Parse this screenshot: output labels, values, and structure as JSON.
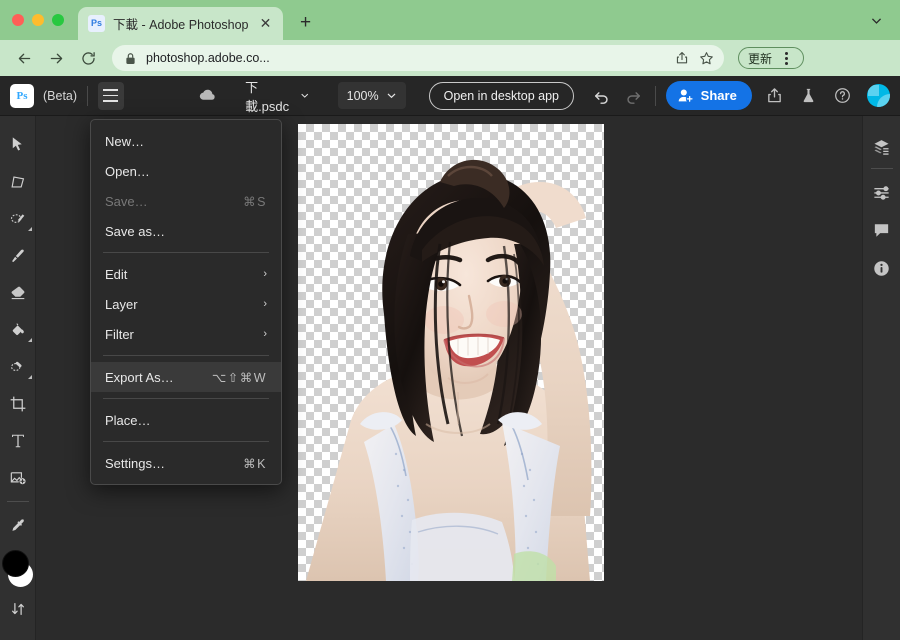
{
  "browser": {
    "tab": {
      "favicon_label": "Ps",
      "title": "下載 - Adobe Photoshop",
      "close_label": "✕"
    },
    "new_tab_label": "+",
    "window_chevron": "⌄",
    "nav": {
      "back": "←",
      "forward": "→",
      "reload": "⟳"
    },
    "omnibox": {
      "lock_icon": "🔒",
      "url": "photoshop.adobe.co...",
      "share_icon": "⇪",
      "bookmark_icon": "☆"
    },
    "update_label": "更新",
    "update_chevron": "⋮",
    "menu_label": "⋮"
  },
  "photoshop": {
    "logo_label": "Ps",
    "beta_label": "(Beta)",
    "hamburger_name": "main-menu",
    "cloud_status": "",
    "filename": "下載.psdc",
    "filename_chevron": "⌄",
    "zoom_level": "100%",
    "zoom_chevron": "⌄",
    "open_desktop_label": "Open in desktop app",
    "undo_label": "↶",
    "redo_label": "↷",
    "share_label": "Share",
    "export_icon": "⇪",
    "lab_icon": "⚗",
    "help_icon": "?",
    "tools": [
      {
        "name": "move-tool",
        "glyph": "cursor"
      },
      {
        "name": "transform-tool",
        "glyph": "transform"
      },
      {
        "name": "object-select-tool",
        "glyph": "object-select"
      },
      {
        "name": "brush-tool",
        "glyph": "brush"
      },
      {
        "name": "eraser-tool",
        "glyph": "eraser"
      },
      {
        "name": "fill-tool",
        "glyph": "fill"
      },
      {
        "name": "spot-healing-tool",
        "glyph": "heal"
      },
      {
        "name": "crop-tool",
        "glyph": "crop"
      },
      {
        "name": "type-tool",
        "glyph": "type"
      },
      {
        "name": "generative-fill-tool",
        "glyph": "genfill"
      },
      {
        "name": "eyedropper-tool",
        "glyph": "eyedropper"
      }
    ],
    "swatch_foreground": "#000000",
    "swatch_background": "#ffffff",
    "swap_label": "⇅",
    "right_rail": [
      {
        "name": "layers-panel-icon"
      },
      {
        "name": "adjustments-panel-icon"
      },
      {
        "name": "comments-panel-icon"
      },
      {
        "name": "info-panel-icon"
      }
    ]
  },
  "menu": {
    "items": [
      {
        "label": "New…",
        "accel": "",
        "arrow": "",
        "state": "normal"
      },
      {
        "label": "Open…",
        "accel": "",
        "arrow": "",
        "state": "normal"
      },
      {
        "label": "Save…",
        "accel": "⌘S",
        "arrow": "",
        "state": "disabled"
      },
      {
        "label": "Save as…",
        "accel": "",
        "arrow": "",
        "state": "normal"
      },
      {
        "separator": true
      },
      {
        "label": "Edit",
        "accel": "",
        "arrow": "›",
        "state": "normal"
      },
      {
        "label": "Layer",
        "accel": "",
        "arrow": "›",
        "state": "normal"
      },
      {
        "label": "Filter",
        "accel": "",
        "arrow": "›",
        "state": "normal"
      },
      {
        "separator": true
      },
      {
        "label": "Export As…",
        "accel": "⌥⇧⌘W",
        "arrow": "",
        "state": "highlight"
      },
      {
        "separator": true
      },
      {
        "label": "Place…",
        "accel": "",
        "arrow": "",
        "state": "normal"
      },
      {
        "separator": true
      },
      {
        "label": "Settings…",
        "accel": "⌘K",
        "arrow": "",
        "state": "normal"
      }
    ]
  },
  "colors": {
    "browser_chrome": "#8fca8f",
    "browser_toolbar": "#c8e6c9",
    "ps_topbar": "#262626",
    "ps_panel": "#303030",
    "ps_canvas_bg": "#2b2b2b",
    "accent_blue": "#1473e6"
  }
}
